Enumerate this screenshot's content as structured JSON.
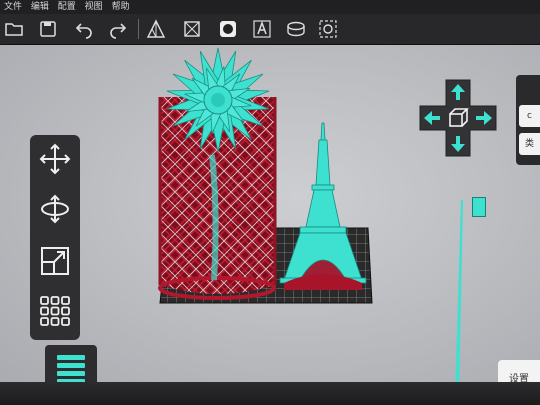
{
  "menu": {
    "items": [
      "文件",
      "编辑",
      "配置",
      "视图",
      "帮助"
    ]
  },
  "toolbar": {
    "icons": [
      "folder-open-icon",
      "save-icon",
      "undo-icon",
      "redo-icon",
      "triangle-mesh-icon",
      "checker-icon",
      "sphere-icon",
      "text-icon",
      "cylinder-icon",
      "camera-icon"
    ]
  },
  "left_panel": {
    "tools": [
      "move-icon",
      "rotate-icon",
      "scale-icon",
      "grid-arrange-icon"
    ],
    "slice_icon": "layers-icon"
  },
  "right_panel": {
    "tab1_label": "c",
    "tab2_label": "类"
  },
  "bottom_right": {
    "settings_label": "设置"
  },
  "colors": {
    "accent": "#3ee0d0",
    "support": "#a8152a",
    "menubar": "#202022",
    "panel": "#2f2f31"
  }
}
